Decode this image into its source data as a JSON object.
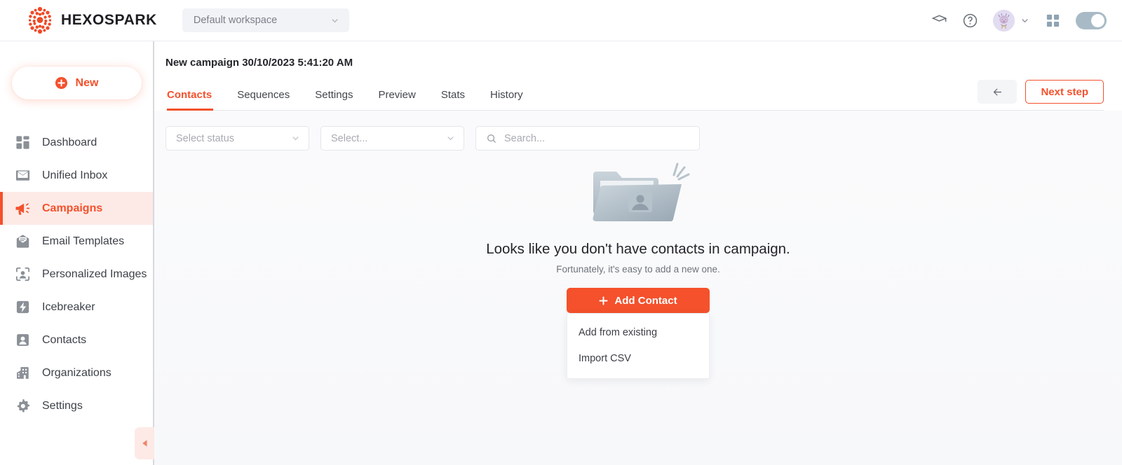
{
  "topbar": {
    "brand_name": "HEXOSPARK",
    "logo_icon": "hexospark-dots-logo",
    "workspace": {
      "value": "Default workspace",
      "chevron_icon": "chevron-down-icon"
    },
    "icons": [
      {
        "name": "graduation-cap-icon",
        "label": "Academy"
      },
      {
        "name": "help-circle-icon",
        "label": "Help"
      }
    ],
    "avatar": {
      "name": "avatar",
      "chevron_icon": "chevron-down-icon"
    },
    "grid_icon": "grid-apps-icon",
    "toggle": {
      "name": "mode-toggle",
      "state": "on",
      "color": "#a8bac6"
    }
  },
  "sidebar": {
    "new_button": {
      "label": "New",
      "icon": "plus-circle-icon"
    },
    "items": [
      {
        "label": "Dashboard",
        "icon": "dashboard-icon",
        "active": false
      },
      {
        "label": "Unified Inbox",
        "icon": "inbox-icon",
        "active": false
      },
      {
        "label": "Campaigns",
        "icon": "megaphone-icon",
        "active": true
      },
      {
        "label": "Email Templates",
        "icon": "email-template-icon",
        "active": false
      },
      {
        "label": "Personalized Images",
        "icon": "personalized-image-icon",
        "active": false
      },
      {
        "label": "Icebreaker",
        "icon": "icebreaker-bolt-icon",
        "active": false
      },
      {
        "label": "Contacts",
        "icon": "contacts-icon",
        "active": false
      },
      {
        "label": "Organizations",
        "icon": "organizations-building-icon",
        "active": false
      },
      {
        "label": "Settings",
        "icon": "gear-icon",
        "active": false
      }
    ],
    "collapse": {
      "icon": "collapse-left-icon"
    }
  },
  "main": {
    "page_title": "New campaign 30/10/2023 5:41:20 AM",
    "tabs": [
      {
        "label": "Contacts",
        "active": true
      },
      {
        "label": "Sequences",
        "active": false
      },
      {
        "label": "Settings",
        "active": false
      },
      {
        "label": "Preview",
        "active": false
      },
      {
        "label": "Stats",
        "active": false
      },
      {
        "label": "History",
        "active": false
      }
    ],
    "back_button": {
      "icon": "arrow-left-icon"
    },
    "next_button": {
      "label": "Next step"
    },
    "filters": {
      "status_select": {
        "placeholder": "Select status",
        "chevron_icon": "chevron-down-icon"
      },
      "generic_select": {
        "placeholder": "Select...",
        "chevron_icon": "chevron-down-icon"
      },
      "search": {
        "placeholder": "Search...",
        "value": "",
        "icon": "search-icon"
      }
    },
    "empty_state": {
      "illustration": "empty-folder-contact-icon",
      "title": "Looks like you don't have contacts in campaign.",
      "subtitle": "Fortunately, it's easy to add a new one.",
      "add_button": {
        "label": "Add Contact",
        "icon": "plus-icon"
      },
      "menu_items": [
        {
          "label": "Add from existing"
        },
        {
          "label": "Import CSV"
        }
      ]
    }
  },
  "colors": {
    "accent": "#f4512c",
    "accent_soft": "#fdeae6",
    "text": "#3d4148",
    "muted": "#a8abb3",
    "toggle": "#a8bac6"
  }
}
